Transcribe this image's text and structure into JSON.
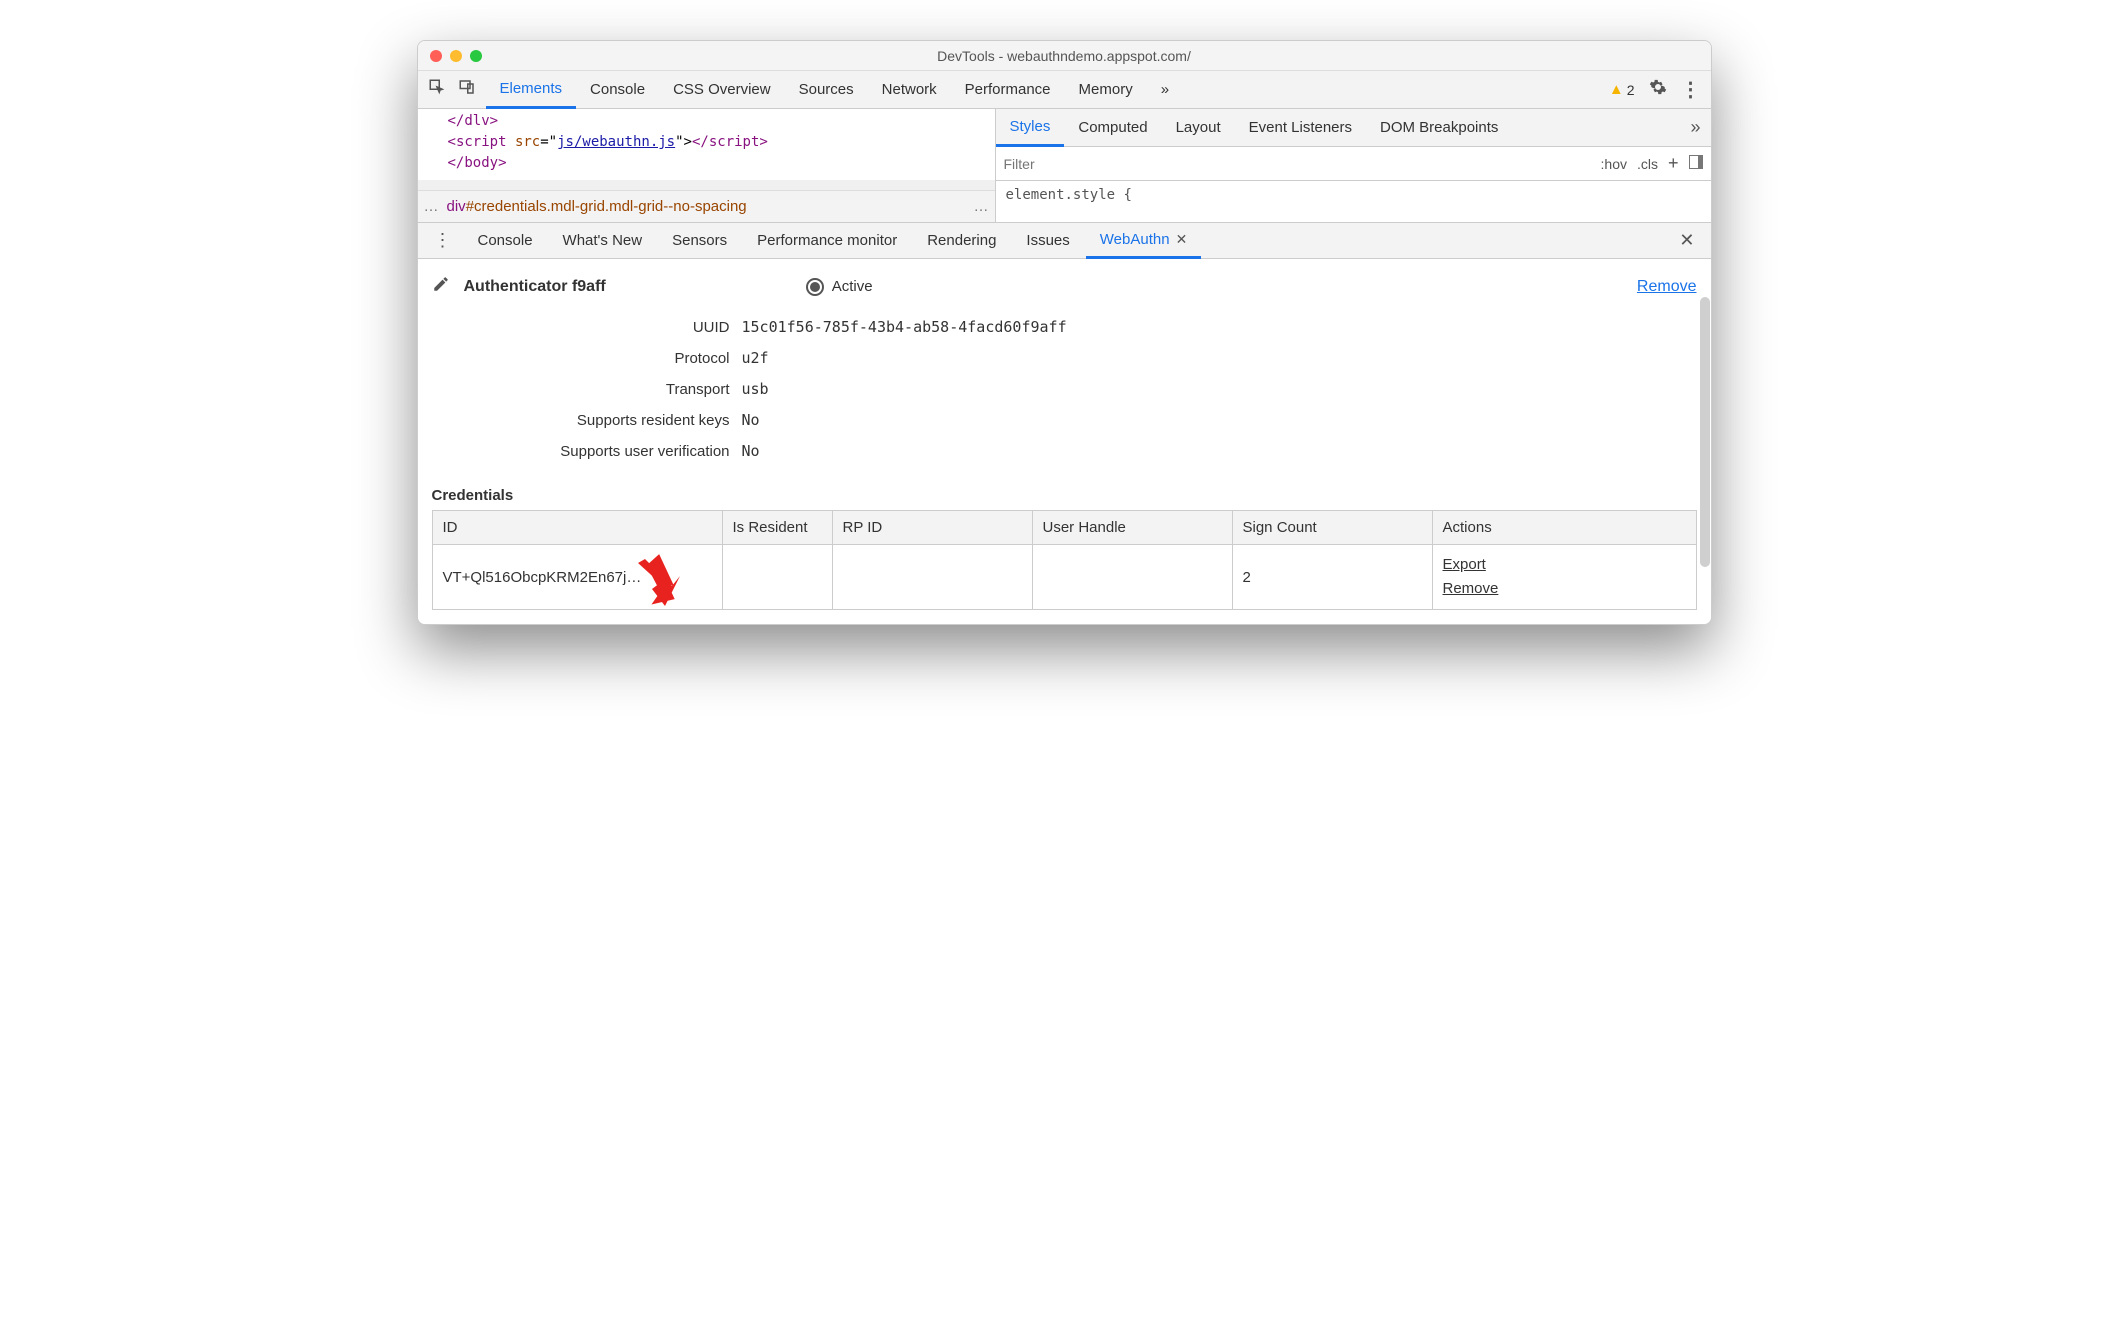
{
  "window": {
    "title": "DevTools - webauthndemo.appspot.com/"
  },
  "main_tabs": [
    "Elements",
    "Console",
    "CSS Overview",
    "Sources",
    "Network",
    "Performance",
    "Memory"
  ],
  "main_tab_active": "Elements",
  "warnings_count": "2",
  "code": {
    "line1a": "</",
    "line1b": "dlv",
    "line1c": ">",
    "line2a": "<",
    "line2b": "script ",
    "line2c": "src",
    "line2d": "=\"",
    "line2e": "js/webauthn.js",
    "line2f": "\">",
    "line2g": "</",
    "line2h": "script",
    "line2i": ">",
    "line3a": "</",
    "line3b": "body",
    "line3c": ">"
  },
  "breadcrumb": {
    "dots_left": "…",
    "tag": "div",
    "id": "#credentials",
    "classes": ".mdl-grid.mdl-grid--no-spacing",
    "dots_right": "…"
  },
  "styles_tabs": [
    "Styles",
    "Computed",
    "Layout",
    "Event Listeners",
    "DOM Breakpoints"
  ],
  "styles_tab_active": "Styles",
  "styles": {
    "filter_placeholder": "Filter",
    "hov": ":hov",
    "cls": ".cls",
    "body": "element.style {"
  },
  "drawer_tabs": [
    "Console",
    "What's New",
    "Sensors",
    "Performance monitor",
    "Rendering",
    "Issues",
    "WebAuthn"
  ],
  "drawer_tab_active": "WebAuthn",
  "authenticator": {
    "title": "Authenticator f9aff",
    "active_label": "Active",
    "remove": "Remove",
    "props": [
      {
        "label": "UUID",
        "value": "15c01f56-785f-43b4-ab58-4facd60f9aff"
      },
      {
        "label": "Protocol",
        "value": "u2f"
      },
      {
        "label": "Transport",
        "value": "usb"
      },
      {
        "label": "Supports resident keys",
        "value": "No"
      },
      {
        "label": "Supports user verification",
        "value": "No"
      }
    ]
  },
  "credentials": {
    "title": "Credentials",
    "headers": [
      "ID",
      "Is Resident",
      "RP ID",
      "User Handle",
      "Sign Count",
      "Actions"
    ],
    "row": {
      "id": "VT+Ql516ObcpKRM2En67j…",
      "is_resident": "",
      "rp_id": "",
      "user_handle": "",
      "sign_count": "2",
      "export": "Export",
      "remove": "Remove"
    }
  }
}
